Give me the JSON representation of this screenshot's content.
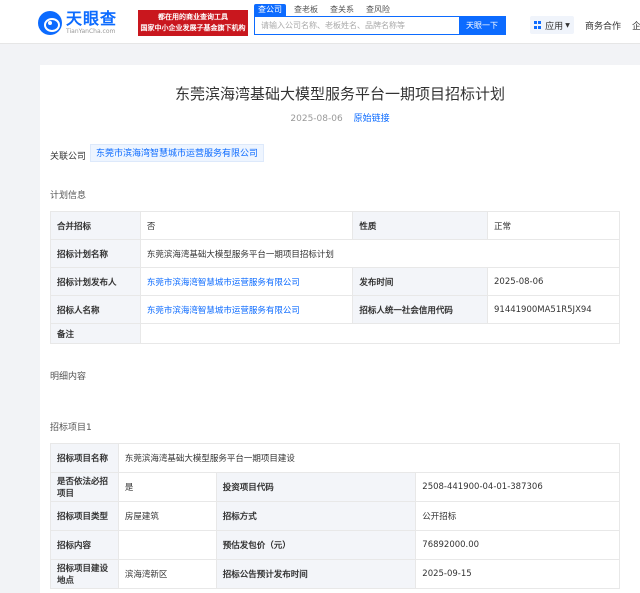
{
  "header": {
    "logo_cn": "天眼查",
    "logo_en": "TianYanCha.com",
    "slogan_line1": "都在用的商业查询工具",
    "slogan_line2": "国家中小企业发展子基金旗下机构",
    "tabs": [
      "查公司",
      "查老板",
      "查关系",
      "查风险"
    ],
    "search_placeholder": "请输入公司名称、老板姓名、品牌名称等",
    "search_button": "天眼一下",
    "app_label": "应用",
    "nav_items": [
      "商务合作",
      "企"
    ]
  },
  "page": {
    "title": "东莞滨海湾基础大模型服务平台一期项目招标计划",
    "date": "2025-08-06",
    "source_link": "原始链接",
    "related_label": "关联公司",
    "related_company": "东莞市滨海湾智慧城市运营服务有限公司",
    "plan_section": "计划信息",
    "detail_section": "明细内容",
    "item_section": "招标项目1"
  },
  "plan_table": {
    "row1": {
      "l1": "合并招标",
      "v1": "否",
      "l2": "性质",
      "v2": "正常"
    },
    "row2": {
      "l1": "招标计划名称",
      "v1": "东莞滨海湾基础大模型服务平台一期项目招标计划"
    },
    "row3": {
      "l1": "招标计划发布人",
      "v1": "东莞市滨海湾智慧城市运营服务有限公司",
      "l2": "发布时间",
      "v2": "2025-08-06"
    },
    "row4": {
      "l1": "招标人名称",
      "v1": "东莞市滨海湾智慧城市运营服务有限公司",
      "l2": "招标人统一社会信用代码",
      "v2": "91441900MA51R5JX94"
    },
    "row5": {
      "l1": "备注",
      "v1": ""
    }
  },
  "item_table": {
    "row1": {
      "l1": "招标项目名称",
      "v1": "东莞滨海湾基础大模型服务平台一期项目建设"
    },
    "row2": {
      "l1": "是否依法必招项目",
      "v1": "是",
      "l2": "投资项目代码",
      "v2": "2508-441900-04-01-387306"
    },
    "row3": {
      "l1": "招标项目类型",
      "v1": "房屋建筑",
      "l2": "招标方式",
      "v2": "公开招标"
    },
    "row4": {
      "l1": "招标内容",
      "v1": "",
      "l2": "预估发包价（元）",
      "v2": "76892000.00"
    },
    "row5": {
      "l1": "招标项目建设地点",
      "v1": "滨海湾新区",
      "l2": "招标公告预计发布时间",
      "v2": "2025-09-15"
    }
  }
}
